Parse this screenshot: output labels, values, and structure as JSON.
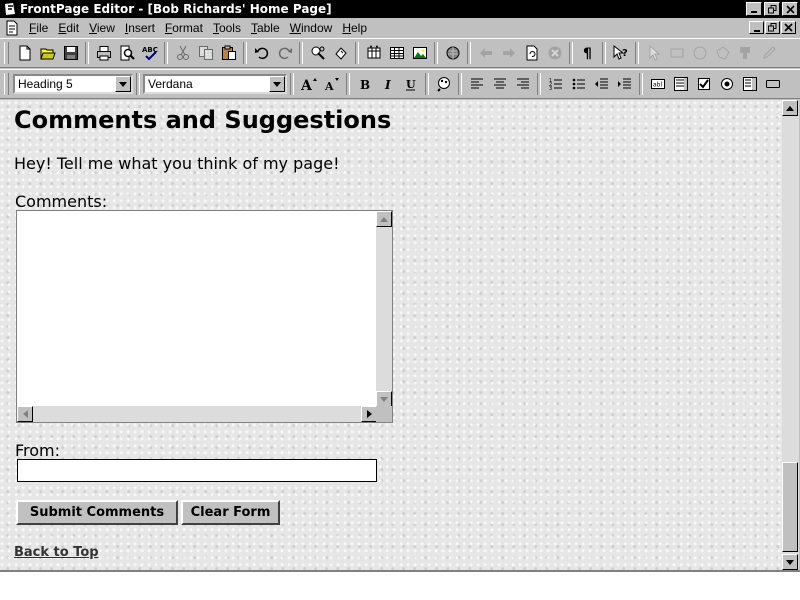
{
  "window": {
    "title": "FrontPage Editor - [Bob Richards' Home Page]"
  },
  "menu": {
    "items": [
      "File",
      "Edit",
      "View",
      "Insert",
      "Format",
      "Tools",
      "Table",
      "Window",
      "Help"
    ]
  },
  "format_toolbar": {
    "style_value": "Heading 5",
    "font_value": "Verdana"
  },
  "page": {
    "heading": "Comments and Suggestions",
    "intro": "Hey! Tell me what you think of my page!",
    "comments_label": "Comments:",
    "comments_value": "",
    "from_label": "From:",
    "from_value": "",
    "submit_label": "Submit Comments",
    "clear_label": "Clear Form",
    "back_link": "Back to Top"
  },
  "icons": {
    "toolbar1": [
      "new-icon",
      "open-icon",
      "save-icon",
      "print-icon",
      "print-preview-icon",
      "spell-check-icon",
      "cut-icon",
      "copy-icon",
      "paste-icon",
      "undo-icon",
      "redo-icon",
      "webbot-icon",
      "format-painter-icon",
      "insert-table-icon",
      "table-icon",
      "image-icon",
      "hyperlink-icon",
      "back-icon",
      "forward-icon",
      "refresh-icon",
      "stop-icon",
      "paragraph-marks-icon",
      "help-icon",
      "pointer-icon",
      "rectangle-icon",
      "circle-icon",
      "polygon-icon",
      "fill-icon",
      "pencil-icon"
    ],
    "toolbar2": [
      "increase-font-icon",
      "decrease-font-icon",
      "bold-icon",
      "italic-icon",
      "underline-icon",
      "text-color-icon",
      "align-left-icon",
      "align-center-icon",
      "align-right-icon",
      "numbered-list-icon",
      "bulleted-list-icon",
      "decrease-indent-icon",
      "increase-indent-icon",
      "text-box-icon",
      "scrolling-text-icon",
      "checkbox-icon",
      "radio-button-icon",
      "dropdown-icon",
      "push-button-icon"
    ]
  }
}
